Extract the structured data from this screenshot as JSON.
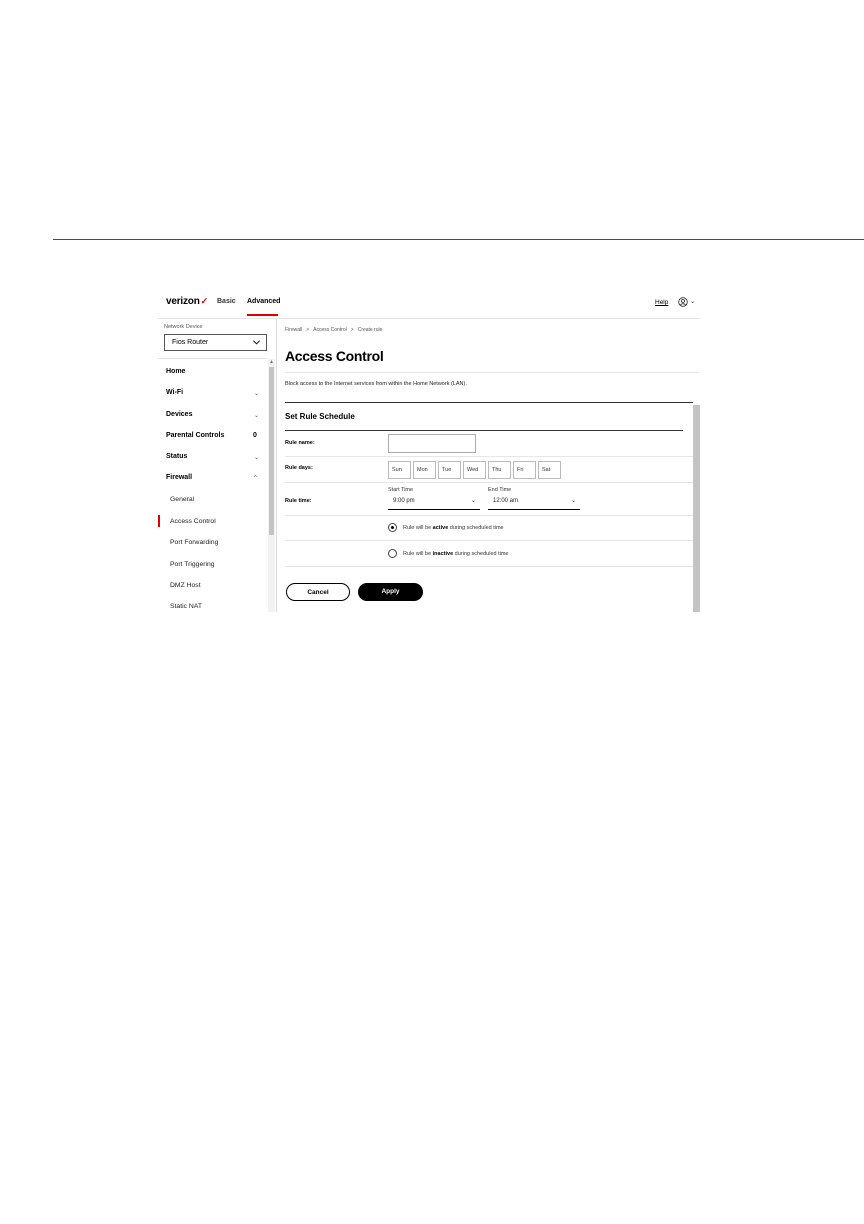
{
  "header": {
    "logo": "verizon",
    "tabs": [
      "Basic",
      "Advanced"
    ],
    "help": "Help"
  },
  "sidebar": {
    "network_device_label": "Network Device",
    "network_device_value": "Fios Router",
    "items": [
      {
        "label": "Home"
      },
      {
        "label": "Wi-Fi"
      },
      {
        "label": "Devices"
      },
      {
        "label": "Parental Controls",
        "badge": "0"
      },
      {
        "label": "Status"
      },
      {
        "label": "Firewall"
      }
    ],
    "firewall_sub": [
      "General",
      "Access Control",
      "Port Forwarding",
      "Port Triggering",
      "DMZ Host",
      "Static NAT"
    ],
    "active_sub": "Access Control"
  },
  "main": {
    "breadcrumbs": [
      "Firewall",
      "Access Control",
      "Create rule"
    ],
    "title": "Access Control",
    "description": "Block access to the Internet services from within the Home Network (LAN).",
    "section_title": "Set Rule Schedule",
    "rule_name_label": "Rule name:",
    "rule_name_value": "",
    "rule_days_label": "Rule days:",
    "days": [
      "Sun",
      "Mon",
      "Tue",
      "Wed",
      "Thu",
      "Fri",
      "Sat"
    ],
    "rule_time_label": "Rule time:",
    "start_time_label": "Start Time",
    "start_time_value": "9:00 pm",
    "end_time_label": "End Time",
    "end_time_value": "12:00 am",
    "radio_active_pre": "Rule will be ",
    "radio_active_bold": "active",
    "radio_active_post": " during scheduled time",
    "radio_inactive_pre": "Rule will be ",
    "radio_inactive_bold": "inactive",
    "radio_inactive_post": " during scheduled time",
    "cancel_label": "Cancel",
    "apply_label": "Apply"
  },
  "colors": {
    "accent": "#e00000",
    "text": "#000000"
  }
}
